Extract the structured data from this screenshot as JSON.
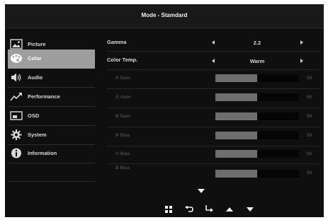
{
  "header": {
    "title": "Mode - Stamdard"
  },
  "sidebar": {
    "items": [
      {
        "label": "Picture",
        "icon": "picture-icon",
        "selected": false
      },
      {
        "label": "Color",
        "icon": "palette-icon",
        "selected": true
      },
      {
        "label": "Audio",
        "icon": "speaker-icon",
        "selected": false
      },
      {
        "label": "Performance",
        "icon": "trend-up-icon",
        "selected": false
      },
      {
        "label": "OSD",
        "icon": "osd-window-icon",
        "selected": false
      },
      {
        "label": "System",
        "icon": "gear-icon",
        "selected": false
      },
      {
        "label": "Information",
        "icon": "info-icon",
        "selected": false
      }
    ]
  },
  "settings": {
    "gamma": {
      "label": "Gamma",
      "value": "2.2"
    },
    "color_temp": {
      "label": "Color Temp.",
      "value": "Warm"
    },
    "sliders": [
      {
        "label": "R Gain",
        "value": "50",
        "fraction": 0.5
      },
      {
        "label": "G Gain",
        "value": "50",
        "fraction": 0.5
      },
      {
        "label": "B Gain",
        "value": "50",
        "fraction": 0.5
      },
      {
        "label": "R Bias",
        "value": "50",
        "fraction": 0.5
      },
      {
        "label": "G Bias",
        "value": "50",
        "fraction": 0.5
      },
      {
        "label": "B Bias",
        "value": "50",
        "fraction": 0.5
      }
    ]
  },
  "footer": {
    "scroll_indicator": "chevron-down-icon",
    "buttons": [
      "menu-grid-icon",
      "back-icon",
      "enter-icon",
      "up-icon",
      "down-icon"
    ]
  },
  "colors": {
    "panel_bg": "#0f0f10",
    "selected_bg": "#9e9e9e",
    "slider_fill": "#6e6e6e",
    "dim_text": "#4a4a4a"
  }
}
